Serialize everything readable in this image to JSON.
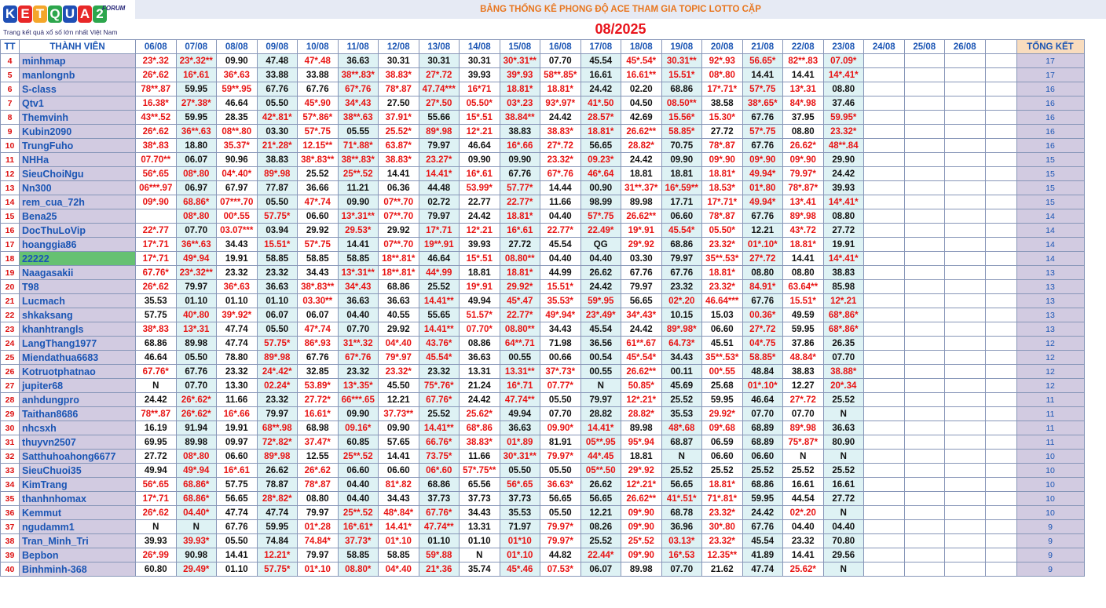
{
  "logo": {
    "brand": "KETQUA2",
    "forum": "FORUM",
    "tagline": "Trang kết quả xổ số lớn nhất Việt Nam",
    "colors": [
      "#1f4fb5",
      "#e82727",
      "#f4a62a",
      "#2ca64c",
      "#1f4fb5",
      "#e82727",
      "#2ca64c"
    ]
  },
  "banner": "BẢNG THỐNG KÊ PHONG ĐỘ ACE THAM GIA TOPIC  LOTTO CẶP",
  "month": "08/2025",
  "headers": {
    "tt": "TT",
    "member": "THÀNH VIÊN",
    "total": "TỔNG KẾT",
    "dates": [
      "06/08",
      "07/08",
      "08/08",
      "09/08",
      "10/08",
      "11/08",
      "12/08",
      "13/08",
      "14/08",
      "15/08",
      "16/08",
      "17/08",
      "18/08",
      "19/08",
      "20/08",
      "21/08",
      "22/08",
      "23/08",
      "24/08",
      "25/08",
      "26/08"
    ]
  },
  "colors": {
    "red": "#e81414",
    "black": "#111111",
    "name": "#1a55b4",
    "name_bg": "#d2cbe1",
    "highlight_bg": "#66c172",
    "alt_col_bg": "#def2f4",
    "banner_text": "#e8761f",
    "month_text": "#e8141c"
  },
  "rows": [
    {
      "tt": "4",
      "name": "minhmap",
      "cells": [
        "23*.32",
        "23*.32**",
        "09.90",
        "47.48",
        "47*.48",
        "36.63",
        "30.31",
        "30.31",
        "30.31",
        "30*.31**",
        "07.70",
        "45.54",
        "45*.54*",
        "30.31**",
        "92*.93",
        "56.65*",
        "82**.83",
        "07.09*"
      ],
      "total": "17"
    },
    {
      "tt": "5",
      "name": "manlongnb",
      "cells": [
        "26*.62",
        "16*.61",
        "36*.63",
        "33.88",
        "33.88",
        "38**.83*",
        "38.83*",
        "27*.72",
        "39.93",
        "39*.93",
        "58**.85*",
        "16.61",
        "16.61**",
        "15.51*",
        "08*.80",
        "14.41",
        "14.41",
        "14*.41*"
      ],
      "total": "17"
    },
    {
      "tt": "6",
      "name": "S-class",
      "cells": [
        "78**.87",
        "59.95",
        "59**.95",
        "67.76",
        "67.76",
        "67*.76",
        "78*.87",
        "47.74***",
        "16*71",
        "18.81*",
        "18.81*",
        "24.42",
        "02.20",
        "68.86",
        "17*.71*",
        "57*.75",
        "13*.31",
        "08.80"
      ],
      "total": "16"
    },
    {
      "tt": "7",
      "name": "Qtv1",
      "cells": [
        "16.38*",
        "27*.38*",
        "46.64",
        "05.50",
        "45*.90",
        "34*.43",
        "27.50",
        "27*.50",
        "05.50*",
        "03*.23",
        "93*.97*",
        "41*.50",
        "04.50",
        "08.50**",
        "38.58",
        "38*.65*",
        "84*.98",
        "37.46"
      ],
      "total": "16"
    },
    {
      "tt": "8",
      "name": "Themvinh",
      "cells": [
        "43**.52",
        "59.95",
        "28.35",
        "42*.81*",
        "57*.86*",
        "38**.63",
        "37.91*",
        "55.66",
        "15*.51",
        "38.84**",
        "24.42",
        "28.57*",
        "42.69",
        "15.56*",
        "15.30*",
        "67.76",
        "37.95",
        "59.95*"
      ],
      "total": "16"
    },
    {
      "tt": "9",
      "name": "Kubin2090",
      "cells": [
        "26*.62",
        "36**.63",
        "08**.80",
        "03.30",
        "57*.75",
        "05.55",
        "25.52*",
        "89*.98",
        "12*.21",
        "38.83",
        "38.83*",
        "18.81*",
        "26.62**",
        "58.85*",
        "27.72",
        "57*.75",
        "08.80",
        "23.32*"
      ],
      "total": "16"
    },
    {
      "tt": "10",
      "name": "TrungFuho",
      "cells": [
        "38*.83",
        "18.80",
        "35.37*",
        "21*.28*",
        "12.15**",
        "71*.88*",
        "63.87*",
        "79.97",
        "46.64",
        "16*.66",
        "27*.72",
        "56.65",
        "28.82*",
        "70.75",
        "78*.87",
        "67.76",
        "26.62*",
        "48**.84"
      ],
      "total": "16"
    },
    {
      "tt": "11",
      "name": "NHHa",
      "cells": [
        "07.70**",
        "06.07",
        "90.96",
        "38.83",
        "38*.83**",
        "38**.83*",
        "38.83*",
        "23.27*",
        "09.90",
        "09.90",
        "23.32*",
        "09.23*",
        "24.42",
        "09.90",
        "09*.90",
        "09*.90",
        "09*.90",
        "29.90"
      ],
      "total": "15"
    },
    {
      "tt": "12",
      "name": "SieuChoiNgu",
      "cells": [
        "56*.65",
        "08*.80",
        "04*.40*",
        "89*.98",
        "25.52",
        "25**.52",
        "14.41",
        "14.41*",
        "16*.61",
        "67.76",
        "67*.76",
        "46*.64",
        "18.81",
        "18.81",
        "18.81*",
        "49.94*",
        "79.97*",
        "24.42"
      ],
      "total": "15"
    },
    {
      "tt": "13",
      "name": "Nn300",
      "cells": [
        "06***.97",
        "06.97",
        "67.97",
        "77.87",
        "36.66",
        "11.21",
        "06.36",
        "44.48",
        "53.99*",
        "57.77*",
        "14.44",
        "00.90",
        "31**.37*",
        "16*.59**",
        "18.53*",
        "01*.80",
        "78*.87*",
        "39.93"
      ],
      "total": "15"
    },
    {
      "tt": "14",
      "name": "rem_cua_72h",
      "cells": [
        "09*.90",
        "68.86*",
        "07***.70",
        "05.50",
        "47*.74",
        "09.90",
        "07**.70",
        "02.72",
        "22.77",
        "22.77*",
        "11.66",
        "98.99",
        "89.98",
        "17.71",
        "17*.71*",
        "49.94*",
        "13*.41",
        "14*.41*"
      ],
      "total": "15"
    },
    {
      "tt": "15",
      "name": "Bena25",
      "cells": [
        "",
        "08*.80",
        "00*.55",
        "57.75*",
        "06.60",
        "13*.31**",
        "07**.70",
        "79.97",
        "24.42",
        "18.81*",
        "04.40",
        "57*.75",
        "26.62**",
        "06.60",
        "78*.87",
        "67.76",
        "89*.98",
        "08.80"
      ],
      "total": "14"
    },
    {
      "tt": "16",
      "name": "DocThuLoVip",
      "cells": [
        "22*.77",
        "07.70",
        "03.07***",
        "03.94",
        "29.92",
        "29.53*",
        "29.92",
        "17*.71",
        "12*.21",
        "16*.61",
        "22.77*",
        "22.49*",
        "19*.91",
        "45.54*",
        "05.50*",
        "12.21",
        "43*.72",
        "27.72"
      ],
      "total": "14"
    },
    {
      "tt": "17",
      "name": "hoanggia86",
      "cells": [
        "17*.71",
        "36**.63",
        "34.43",
        "15.51*",
        "57*.75",
        "14.41",
        "07**.70",
        "19**.91",
        "39.93",
        "27.72",
        "45.54",
        "QG",
        "29*.92",
        "68.86",
        "23.32*",
        "01*.10*",
        "18.81*",
        "19.91"
      ],
      "total": "14"
    },
    {
      "tt": "18",
      "name": "22222",
      "cells": [
        "17*.71",
        "49*.94",
        "19.91",
        "58.85",
        "58.85",
        "58.85",
        "18**.81*",
        "46.64",
        "15*.51",
        "08.80**",
        "04.40",
        "04.40",
        "03.30",
        "79.97",
        "35**.53*",
        "27*.72",
        "14.41",
        "14*.41*"
      ],
      "total": "14"
    },
    {
      "tt": "19",
      "name": "Naagasakii",
      "cells": [
        "67.76*",
        "23*.32**",
        "23.32",
        "23.32",
        "34.43",
        "13*.31**",
        "18**.81*",
        "44*.99",
        "18.81",
        "18.81*",
        "44.99",
        "26.62",
        "67.76",
        "67.76",
        "18.81*",
        "08.80",
        "08.80",
        "38.83"
      ],
      "total": "13"
    },
    {
      "tt": "20",
      "name": "T98",
      "cells": [
        "26*.62",
        "79.97",
        "36*.63",
        "36.63",
        "38*.83**",
        "34*.43",
        "68.86",
        "25.52",
        "19*.91",
        "29.92*",
        "15.51*",
        "24.42",
        "79.97",
        "23.32",
        "23.32*",
        "84.91*",
        "63.64**",
        "85.98"
      ],
      "total": "13"
    },
    {
      "tt": "21",
      "name": "Lucmach",
      "cells": [
        "35.53",
        "01.10",
        "01.10",
        "01.10",
        "03.30**",
        "36.63",
        "36.63",
        "14.41**",
        "49.94",
        "45*.47",
        "35.53*",
        "59*.95",
        "56.65",
        "02*.20",
        "46.64***",
        "67.76",
        "15.51*",
        "12*.21"
      ],
      "total": "13"
    },
    {
      "tt": "22",
      "name": "shkaksang",
      "cells": [
        "57.75",
        "40*.80",
        "39*.92*",
        "06.07",
        "06.07",
        "04.40",
        "40.55",
        "55.65",
        "51.57*",
        "22.77*",
        "49*.94*",
        "23*.49*",
        "34*.43*",
        "10.15",
        "15.03",
        "00.36*",
        "49.59",
        "68*.86*"
      ],
      "total": "13"
    },
    {
      "tt": "23",
      "name": "khanhtrangls",
      "cells": [
        "38*.83",
        "13*.31",
        "47.74",
        "05.50",
        "47*.74",
        "07.70",
        "29.92",
        "14.41**",
        "07.70*",
        "08.80**",
        "34.43",
        "45.54",
        "24.42",
        "89*.98*",
        "06.60",
        "27*.72",
        "59.95",
        "68*.86*"
      ],
      "total": "13"
    },
    {
      "tt": "24",
      "name": "LangThang1977",
      "cells": [
        "68.86",
        "89.98",
        "47.74",
        "57.75*",
        "86*.93",
        "31**.32",
        "04*.40",
        "43.76*",
        "08.86",
        "64**.71",
        "71.98",
        "36.56",
        "61**.67",
        "64.73*",
        "45.51",
        "04*.75",
        "37.86",
        "26.35"
      ],
      "total": "12"
    },
    {
      "tt": "25",
      "name": "Miendathua6683",
      "cells": [
        "46.64",
        "05.50",
        "78.80",
        "89*.98",
        "67.76",
        "67*.76",
        "79*.97",
        "45.54*",
        "36.63",
        "00.55",
        "00.66",
        "00.54",
        "45*.54*",
        "34.43",
        "35**.53*",
        "58.85*",
        "48.84*",
        "07.70"
      ],
      "total": "12"
    },
    {
      "tt": "26",
      "name": "Kotruotphatnao",
      "cells": [
        "67.76*",
        "67.76",
        "23.32",
        "24*.42*",
        "32.85",
        "23.32",
        "23.32*",
        "23.32",
        "13.31",
        "13.31**",
        "37*.73*",
        "00.55",
        "26.62**",
        "00.11",
        "00*.55",
        "48.84",
        "38.83",
        "38.88*"
      ],
      "total": "12"
    },
    {
      "tt": "27",
      "name": "jupiter68",
      "cells": [
        "N",
        "07.70",
        "13.30",
        "02.24*",
        "53.89*",
        "13*.35*",
        "45.50",
        "75*.76*",
        "21.24",
        "16*.71",
        "07.77*",
        "N",
        "50.85*",
        "45.69",
        "25.68",
        "01*.10*",
        "12.27",
        "20*.34"
      ],
      "total": "12"
    },
    {
      "tt": "28",
      "name": "anhdungpro",
      "cells": [
        "24.42",
        "26*.62*",
        "11.66",
        "23.32",
        "27.72*",
        "66***.65",
        "12.21",
        "67.76*",
        "24.42",
        "47.74**",
        "05.50",
        "79.97",
        "12*.21*",
        "25.52",
        "59.95",
        "46.64",
        "27*.72",
        "25.52"
      ],
      "total": "11"
    },
    {
      "tt": "29",
      "name": "Taithan8686",
      "cells": [
        "78**.87",
        "26*.62*",
        "16*.66",
        "79.97",
        "16.61*",
        "09.90",
        "37.73**",
        "25.52",
        "25.62*",
        "49.94",
        "07.70",
        "28.82",
        "28.82*",
        "35.53",
        "29.92*",
        "07.70",
        "07.70",
        "N"
      ],
      "total": "11"
    },
    {
      "tt": "30",
      "name": "nhcsxh",
      "cells": [
        "16.19",
        "91.94",
        "19.91",
        "68**.98",
        "68.98",
        "09.16*",
        "09.90",
        "14.41**",
        "68*.86",
        "36.63",
        "09.90*",
        "14.41*",
        "89.98",
        "48*.68",
        "09*.68",
        "68.89",
        "89*.98",
        "36.63"
      ],
      "total": "11"
    },
    {
      "tt": "31",
      "name": "thuyvn2507",
      "cells": [
        "69.95",
        "89.98",
        "09.97",
        "72*.82*",
        "37.47*",
        "60.85",
        "57.65",
        "66.76*",
        "38.83*",
        "01*.89",
        "81.91",
        "05**.95",
        "95*.94",
        "68.87",
        "06.59",
        "68.89",
        "75*.87*",
        "80.90"
      ],
      "total": "11"
    },
    {
      "tt": "32",
      "name": "Satthuhoahong6677",
      "cells": [
        "27.72",
        "08*.80",
        "06.60",
        "89*.98",
        "12.55",
        "25**.52",
        "14.41",
        "73.75*",
        "11.66",
        "30*.31**",
        "79.97*",
        "44*.45",
        "18.81",
        "N",
        "06.60",
        "06.60",
        "N",
        "N"
      ],
      "total": "10"
    },
    {
      "tt": "33",
      "name": "SieuChuoi35",
      "cells": [
        "49.94",
        "49*.94",
        "16*.61",
        "26.62",
        "26*.62",
        "06.60",
        "06.60",
        "06*.60",
        "57*.75**",
        "05.50",
        "05.50",
        "05**.50",
        "29*.92",
        "25.52",
        "25.52",
        "25.52",
        "25.52",
        "25.52"
      ],
      "total": "10"
    },
    {
      "tt": "34",
      "name": "KimTrang",
      "cells": [
        "56*.65",
        "68.86*",
        "57.75",
        "78.87",
        "78*.87",
        "04.40",
        "81*.82",
        "68.86",
        "65.56",
        "56*.65",
        "36.63*",
        "26.62",
        "12*.21*",
        "56.65",
        "18.81*",
        "68.86",
        "16.61",
        "16.61"
      ],
      "total": "10"
    },
    {
      "tt": "35",
      "name": "thanhnhomax",
      "cells": [
        "17*.71",
        "68.86*",
        "56.65",
        "28*.82*",
        "08.80",
        "04.40",
        "34.43",
        "37.73",
        "37.73",
        "37.73",
        "56.65",
        "56.65",
        "26.62**",
        "41*.51*",
        "71*.81*",
        "59.95",
        "44.54",
        "27.72"
      ],
      "total": "10"
    },
    {
      "tt": "36",
      "name": "Kemmut",
      "cells": [
        "26*.62",
        "04.40*",
        "47.74",
        "47.74",
        "79.97",
        "25**.52",
        "48*.84*",
        "67.76*",
        "34.43",
        "35.53",
        "05.50",
        "12.21",
        "09*.90",
        "68.78",
        "23.32*",
        "24.42",
        "02*.20",
        "N"
      ],
      "total": "10"
    },
    {
      "tt": "37",
      "name": "ngudamm1",
      "cells": [
        "N",
        "N",
        "67.76",
        "59.95",
        "01*.28",
        "16*.61*",
        "14.41*",
        "47.74**",
        "13.31",
        "71.97",
        "79.97*",
        "08.26",
        "09*.90",
        "36.96",
        "30*.80",
        "67.76",
        "04.40",
        "04.40"
      ],
      "total": "9"
    },
    {
      "tt": "38",
      "name": "Tran_Minh_Tri",
      "cells": [
        "39.93",
        "39.93*",
        "05.50",
        "74.84",
        "74.84*",
        "37.73*",
        "01*.10",
        "01.10",
        "01.10",
        "01*10",
        "79.97*",
        "25.52",
        "25*.52",
        "03.13*",
        "23.32*",
        "45.54",
        "23.32",
        "70.80"
      ],
      "total": "9"
    },
    {
      "tt": "39",
      "name": "Bepbon",
      "cells": [
        "26*.99",
        "90.98",
        "14.41",
        "12.21*",
        "79.97",
        "58.85",
        "58.85",
        "59*.88",
        "N",
        "01*.10",
        "44.82",
        "22.44*",
        "09*.90",
        "16*.53",
        "12.35**",
        "41.89",
        "14.41",
        "29.56"
      ],
      "total": "9"
    },
    {
      "tt": "40",
      "name": "Binhminh-368",
      "cells": [
        "60.80",
        "29.49*",
        "01.10",
        "57.75*",
        "01*.10",
        "08.80*",
        "04*.40",
        "21*.36",
        "35.74",
        "45*.46",
        "07.53*",
        "06.07",
        "89.98",
        "07.70",
        "21.62",
        "47.74",
        "25.62*",
        "N"
      ],
      "total": "9"
    }
  ]
}
